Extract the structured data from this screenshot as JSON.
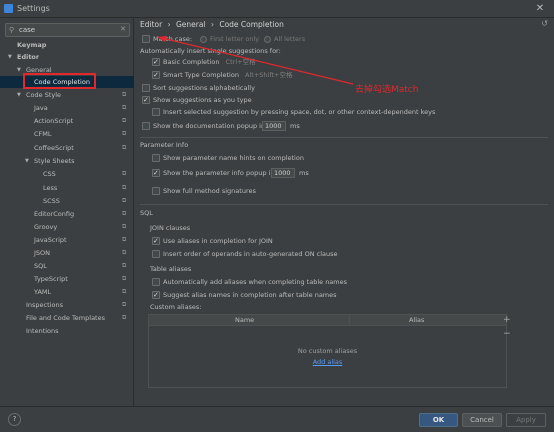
{
  "window": {
    "title": "Settings",
    "close": "✕"
  },
  "search": {
    "value": "case",
    "icon": "search-icon"
  },
  "tree": [
    {
      "label": "Keymap"
    },
    {
      "label": "Editor"
    },
    {
      "label": "General"
    },
    {
      "label": "Code Completion"
    },
    {
      "label": "Code Style"
    },
    {
      "label": "Java"
    },
    {
      "label": "ActionScript"
    },
    {
      "label": "CFML"
    },
    {
      "label": "CoffeeScript"
    },
    {
      "label": "Style Sheets"
    },
    {
      "label": "CSS"
    },
    {
      "label": "Less"
    },
    {
      "label": "SCSS"
    },
    {
      "label": "EditorConfig"
    },
    {
      "label": "Groovy"
    },
    {
      "label": "JavaScript"
    },
    {
      "label": "JSON"
    },
    {
      "label": "SQL"
    },
    {
      "label": "TypeScript"
    },
    {
      "label": "YAML"
    },
    {
      "label": "Inspections"
    },
    {
      "label": "File and Code Templates"
    },
    {
      "label": "Intentions"
    }
  ],
  "breadcrumb": [
    "Editor",
    "›",
    "General",
    "›",
    "Code Completion"
  ],
  "options": {
    "match_case": "Match case:",
    "first_letter": "First letter only",
    "all_letters": "All letters",
    "auto_insert": "Automatically insert single suggestions for:",
    "basic": "Basic Completion",
    "basic_key": "Ctrl+空格",
    "smart": "Smart Type Completion",
    "smart_key": "Alt+Shift+空格",
    "sort": "Sort suggestions alphabetically",
    "show_as_type": "Show suggestions as you type",
    "insert_selected": "Insert selected suggestion by pressing space, dot, or other context-dependent keys",
    "doc_popup_pre": "Show the documentation popup in",
    "doc_popup_val": "1000",
    "doc_popup_unit": "ms"
  },
  "param_info": {
    "header": "Parameter Info",
    "hints": "Show parameter name hints on completion",
    "popup_pre": "Show the parameter info popup in",
    "popup_val": "1000",
    "popup_unit": "ms",
    "full_sig": "Show full method signatures"
  },
  "sql": {
    "header": "SQL",
    "join_header": "JOIN clauses",
    "join_aliases": "Use aliases in completion for JOIN",
    "insert_on": "Insert order of operands in auto-generated ON clause",
    "table_header": "Table aliases",
    "auto_add": "Automatically add aliases when completing table names",
    "suggest": "Suggest alias names in completion after table names",
    "custom": "Custom aliases:",
    "col_name": "Name",
    "col_alias": "Alias",
    "empty": "No custom aliases",
    "add": "Add alias"
  },
  "annotation": "去掉勾选Match",
  "footer": {
    "help": "?",
    "ok": "OK",
    "cancel": "Cancel",
    "apply": "Apply"
  },
  "colors": {
    "accent": "#365880",
    "selection": "#0d293e",
    "annotation": "#e0282d",
    "link": "#589df6"
  }
}
